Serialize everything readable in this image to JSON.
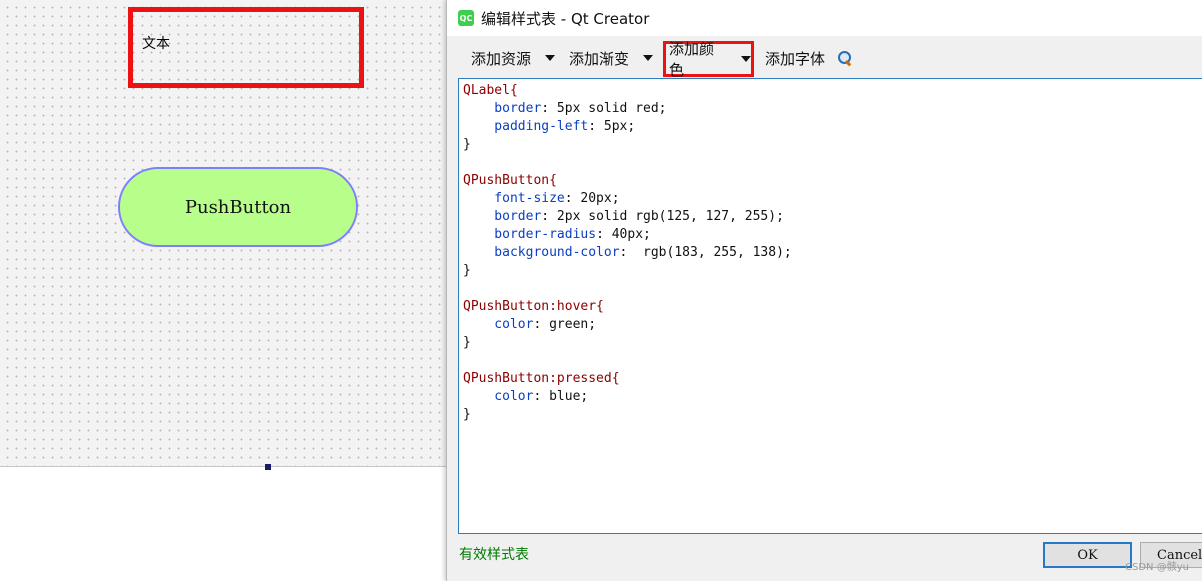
{
  "canvas": {
    "label_text": "文本",
    "button_text": "PushButton"
  },
  "dialog": {
    "icon_text": "QC",
    "title": "编辑样式表 - Qt Creator",
    "toolbar": {
      "add_resource": "添加资源",
      "add_gradient": "添加渐变",
      "add_color": "添加颜色",
      "add_font": "添加字体"
    },
    "code_lines": [
      [
        {
          "t": "QLabel{",
          "c": "sel"
        }
      ],
      [
        {
          "t": "    border",
          "c": "prop"
        },
        {
          "t": ": 5px solid red;",
          "c": "val"
        }
      ],
      [
        {
          "t": "    padding-left",
          "c": "prop"
        },
        {
          "t": ": 5px;",
          "c": "val"
        }
      ],
      [
        {
          "t": "}",
          "c": "brace"
        }
      ],
      [],
      [
        {
          "t": "QPushButton{",
          "c": "sel"
        }
      ],
      [
        {
          "t": "    font-size",
          "c": "prop"
        },
        {
          "t": ": 20px;",
          "c": "val"
        }
      ],
      [
        {
          "t": "    border",
          "c": "prop"
        },
        {
          "t": ": 2px solid rgb(125, 127, 255);",
          "c": "val"
        }
      ],
      [
        {
          "t": "    border-radius",
          "c": "prop"
        },
        {
          "t": ": 40px;",
          "c": "val"
        }
      ],
      [
        {
          "t": "    background-color",
          "c": "prop"
        },
        {
          "t": ":  rgb(183, 255, 138);",
          "c": "val"
        }
      ],
      [
        {
          "t": "}",
          "c": "brace"
        }
      ],
      [],
      [
        {
          "t": "QPushButton:hover{",
          "c": "sel"
        }
      ],
      [
        {
          "t": "    color",
          "c": "prop"
        },
        {
          "t": ": green;",
          "c": "val"
        }
      ],
      [
        {
          "t": "}",
          "c": "brace"
        }
      ],
      [],
      [
        {
          "t": "QPushButton:pressed{",
          "c": "sel"
        }
      ],
      [
        {
          "t": "    color",
          "c": "prop"
        },
        {
          "t": ": blue;",
          "c": "val"
        }
      ],
      [
        {
          "t": "}",
          "c": "brace"
        }
      ]
    ],
    "status": "有效样式表",
    "ok_label": "OK",
    "cancel_label": "Cancel",
    "watermark": "CSDN @骸yu"
  },
  "colors": {
    "highlight_red": "#ee1111",
    "button_bg": "#b7ff8a",
    "button_border": "#7d7fff",
    "selector": "#8b0000",
    "property": "#0a3ec4",
    "valid_status": "#007b00"
  },
  "icons": [
    "qt-creator-icon",
    "dropdown-arrow-icon",
    "preview-magnifier-icon"
  ]
}
